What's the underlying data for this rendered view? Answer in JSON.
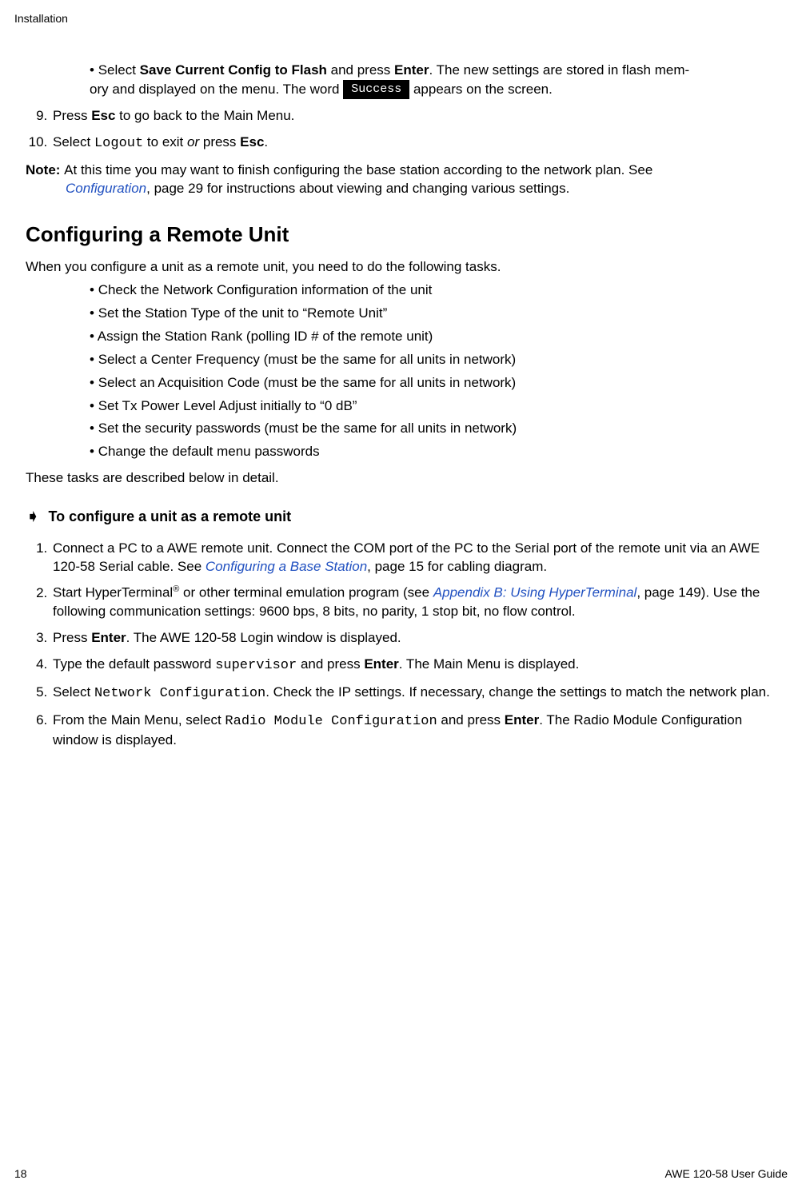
{
  "running_head": "Installation",
  "prev_bullet": {
    "line1a": "Select ",
    "line1b": "Save Current Config to Flash",
    "line1c": " and press ",
    "line1d": "Enter",
    "line1e": ". The new settings are stored in flash mem-",
    "line2a": "ory and displayed on the menu. The word  ",
    "badge": "Success",
    "line2b": "  appears on the screen."
  },
  "prev_steps": {
    "s9a": "Press ",
    "s9b": "Esc",
    "s9c": " to go back to the Main Menu.",
    "s10a": "Select ",
    "s10b": "Logout",
    "s10c": " to exit ",
    "s10d": "or ",
    "s10e": " press ",
    "s10f": "Esc",
    "s10g": "."
  },
  "note": {
    "label": "Note: ",
    "t1": "At this time you may want to finish configuring the base station according to the network plan. See ",
    "link": "Configuration",
    "t2": ", page 29 for instructions about viewing and changing various settings."
  },
  "section_title": "Configuring a Remote Unit",
  "intro": "When you configure a unit as a remote unit, you need to do the following tasks.",
  "tasks": [
    "Check the Network Configuration information of the unit",
    "Set the Station Type of the unit to “Remote Unit”",
    "Assign the Station Rank (polling ID # of the remote unit)",
    "Select a Center Frequency (must be the same for all units in network)",
    "Select an Acquisition Code (must be the same for all units in network)",
    "Set Tx Power Level Adjust initially to “0 dB”",
    "Set the security passwords (must be the same for all units in network)",
    "Change the default menu passwords"
  ],
  "outro": "These tasks are described below in detail.",
  "proc_title": "To configure a unit as a remote unit",
  "steps": {
    "s1a": "Connect a PC to a AWE remote unit. Connect the COM port of the PC to the Serial port of the remote unit via an AWE 120-58 Serial cable. See ",
    "s1b": "Configuring a Base Station",
    "s1c": ", page 15 for cabling diagram.",
    "s2a": "Start HyperTerminal",
    "s2sup": "®",
    "s2b": " or other terminal emulation program (see ",
    "s2c": "Appendix B: Using HyperTerminal",
    "s2d": ", page 149). Use the following communication settings: 9600 bps, 8 bits, no parity, 1 stop bit, no flow control.",
    "s3a": "Press ",
    "s3b": "Enter",
    "s3c": ". The AWE 120-58 Login window is displayed.",
    "s4a": "Type the default password ",
    "s4b": "supervisor",
    "s4c": " and press ",
    "s4d": "Enter",
    "s4e": ". The Main Menu is displayed.",
    "s5a": "Select ",
    "s5b": "Network Configuration",
    "s5c": ". Check the IP settings. If necessary, change the settings to match the network plan.",
    "s6a": "From the Main Menu, select ",
    "s6b": "Radio Module Configuration",
    "s6c": " and press ",
    "s6d": "Enter",
    "s6e": ". The Radio Module Configuration window is displayed."
  },
  "footer": {
    "page_no": "18",
    "doc_title": "AWE 120-58 User Guide"
  }
}
